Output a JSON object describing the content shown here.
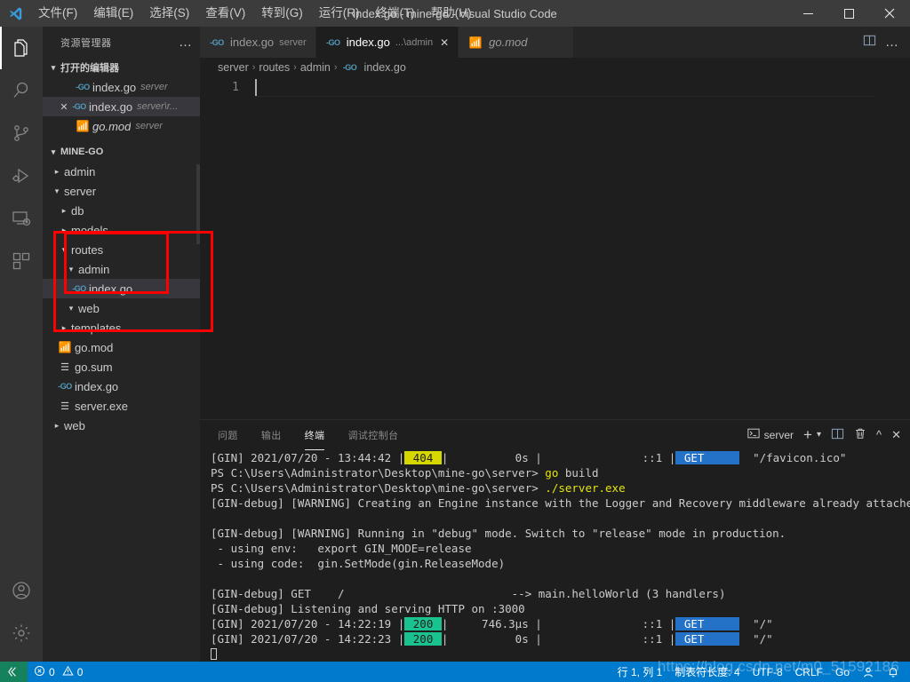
{
  "titlebar": {
    "title": "index.go - mine-go - Visual Studio Code",
    "logo_icon": "vscode-logo",
    "menus": [
      {
        "label": "文件(F)",
        "name": "menu-file"
      },
      {
        "label": "编辑(E)",
        "name": "menu-edit"
      },
      {
        "label": "选择(S)",
        "name": "menu-selection"
      },
      {
        "label": "查看(V)",
        "name": "menu-view"
      },
      {
        "label": "转到(G)",
        "name": "menu-go"
      },
      {
        "label": "运行(R)",
        "name": "menu-run"
      },
      {
        "label": "终端(T)",
        "name": "menu-terminal"
      },
      {
        "label": "帮助(H)",
        "name": "menu-help"
      }
    ],
    "minimize": "—",
    "maximize": "□",
    "close": "✕"
  },
  "activitybar": {
    "items": [
      {
        "icon": "explorer-icon",
        "active": true
      },
      {
        "icon": "search-icon",
        "active": false
      },
      {
        "icon": "source-control-icon",
        "active": false
      },
      {
        "icon": "run-and-debug-icon",
        "active": false
      },
      {
        "icon": "remote-explorer-icon",
        "active": false
      },
      {
        "icon": "extensions-icon",
        "active": false
      }
    ],
    "bottom": [
      {
        "icon": "account-icon"
      },
      {
        "icon": "settings-gear-icon"
      }
    ]
  },
  "sidebar": {
    "header": "资源管理器",
    "more_actions": "…",
    "open_editors": {
      "title": "打开的编辑器",
      "items": [
        {
          "name": "index.go",
          "desc": "server",
          "icon": "go-file-icon",
          "selected": false,
          "has_close": false
        },
        {
          "name": "index.go",
          "desc": "server\\r...",
          "icon": "go-file-icon",
          "selected": true,
          "has_close": true
        },
        {
          "name": "go.mod",
          "desc": "server",
          "icon": "go-mod-icon",
          "selected": false,
          "has_close": false
        }
      ]
    },
    "project": {
      "title": "MINE-GO",
      "tree": [
        {
          "label": "admin",
          "indent": 1,
          "type": "folder",
          "expanded": false
        },
        {
          "label": "server",
          "indent": 1,
          "type": "folder",
          "expanded": true
        },
        {
          "label": "db",
          "indent": 2,
          "type": "folder",
          "expanded": false
        },
        {
          "label": "models",
          "indent": 2,
          "type": "folder",
          "expanded": false
        },
        {
          "label": "routes",
          "indent": 2,
          "type": "folder",
          "expanded": true
        },
        {
          "label": "admin",
          "indent": 3,
          "type": "folder",
          "expanded": true
        },
        {
          "label": "index.go",
          "indent": 4,
          "type": "go",
          "selected": true
        },
        {
          "label": "web",
          "indent": 3,
          "type": "folder",
          "expanded": true
        },
        {
          "label": "templates",
          "indent": 2,
          "type": "folder",
          "expanded": false
        },
        {
          "label": "go.mod",
          "indent": 2,
          "type": "mod"
        },
        {
          "label": "go.sum",
          "indent": 2,
          "type": "txt"
        },
        {
          "label": "index.go",
          "indent": 2,
          "type": "go"
        },
        {
          "label": "server.exe",
          "indent": 2,
          "type": "txt"
        },
        {
          "label": "web",
          "indent": 1,
          "type": "folder",
          "expanded": false
        }
      ]
    },
    "annotations": [
      {
        "name": "annotation-inner-rect",
        "color": "#fe0000"
      },
      {
        "name": "annotation-outer-rect",
        "color": "#fe0000"
      }
    ]
  },
  "editor": {
    "tabs": [
      {
        "label": "index.go",
        "desc": "server",
        "icon": "go-file-icon",
        "active": false,
        "closable": false
      },
      {
        "label": "index.go",
        "desc": "...\\admin",
        "icon": "go-file-icon",
        "active": true,
        "closable": true,
        "close": "✕"
      },
      {
        "label": "go.mod",
        "desc": "",
        "icon": "go-mod-icon",
        "active": false,
        "closable": false
      }
    ],
    "tab_actions": [
      {
        "icon": "split-editor-icon"
      },
      {
        "icon": "more-actions-icon",
        "label": "…"
      }
    ],
    "breadcrumb": [
      "server",
      "routes",
      "admin",
      "index.go"
    ],
    "breadcrumb_file_icon": "go-file-icon",
    "separator": "›",
    "line_number": "1",
    "content": ""
  },
  "panel": {
    "tabs": [
      {
        "label": "问题",
        "active": false
      },
      {
        "label": "输出",
        "active": false
      },
      {
        "label": "终端",
        "active": true
      },
      {
        "label": "调试控制台",
        "active": false
      }
    ],
    "terminal_name": "server",
    "terminal_icon": "terminal-icon",
    "actions": [
      {
        "icon": "new-terminal-icon",
        "label": "+"
      },
      {
        "icon": "chevron-down-icon",
        "label": "⌄"
      },
      {
        "icon": "split-terminal-icon"
      },
      {
        "icon": "kill-terminal-icon"
      },
      {
        "icon": "chevron-up-icon",
        "label": "⌃"
      },
      {
        "icon": "close-panel-icon",
        "label": "✕"
      }
    ],
    "terminal_lines": [
      [
        {
          "t": "[GIN] 2021/07/20 - 13:44:42 |"
        },
        {
          "t": " 404 ",
          "s": "hl-yellow"
        },
        {
          "t": "|          0s |               ::1 |"
        },
        {
          "t": " GET     ",
          "s": "hl-blue"
        },
        {
          "t": "  \"/favicon.ico\""
        }
      ],
      [
        {
          "t": "PS C:\\Users\\Administrator\\Desktop\\mine-go\\server> "
        },
        {
          "t": "go",
          "s": "c-yellow"
        },
        {
          "t": " build"
        }
      ],
      [
        {
          "t": "PS C:\\Users\\Administrator\\Desktop\\mine-go\\server> "
        },
        {
          "t": "./server.exe",
          "s": "c-yellow"
        }
      ],
      [
        {
          "t": "[GIN-debug] [WARNING] Creating an Engine instance with the Logger and Recovery middleware already attached."
        }
      ],
      [
        {
          "t": ""
        }
      ],
      [
        {
          "t": "[GIN-debug] [WARNING] Running in \"debug\" mode. Switch to \"release\" mode in production."
        }
      ],
      [
        {
          "t": " - using env:   export GIN_MODE=release"
        }
      ],
      [
        {
          "t": " - using code:  gin.SetMode(gin.ReleaseMode)"
        }
      ],
      [
        {
          "t": ""
        }
      ],
      [
        {
          "t": "[GIN-debug] GET    /                         --> main.helloWorld (3 handlers)"
        }
      ],
      [
        {
          "t": "[GIN-debug] Listening and serving HTTP on :3000"
        }
      ],
      [
        {
          "t": "[GIN] 2021/07/20 - 14:22:19 |"
        },
        {
          "t": " 200 ",
          "s": "hl-green"
        },
        {
          "t": "|     746.3µs |               ::1 |"
        },
        {
          "t": " GET     ",
          "s": "hl-blue"
        },
        {
          "t": "  \"/\""
        }
      ],
      [
        {
          "t": "[GIN] 2021/07/20 - 14:22:23 |"
        },
        {
          "t": " 200 ",
          "s": "hl-green"
        },
        {
          "t": "|          0s |               ::1 |"
        },
        {
          "t": " GET     ",
          "s": "hl-blue"
        },
        {
          "t": "  \"/\""
        }
      ]
    ],
    "prompt_cursor": "⎕"
  },
  "statusbar": {
    "remote_icon": "remote-window-icon",
    "problems": {
      "error_icon": "error-circle-icon",
      "errors": "0",
      "warning_icon": "warning-triangle-icon",
      "warnings": "0"
    },
    "cursor_position": "行 1, 列 1",
    "indentation": "制表符长度: 4",
    "encoding": "UTF-8",
    "eol": "CRLF",
    "language": "Go",
    "feedback_icon": "feedback-smiley-icon",
    "bell_icon": "notifications-bell-icon"
  },
  "watermark": "https://blog.csdn.net/m0_51592186",
  "colors": {
    "accent": "#007acc",
    "remote_green": "#16825d",
    "annotation_red": "#fe0000",
    "status_404": "#d7d700",
    "status_200": "#19c28e",
    "method_get": "#2472c8"
  }
}
